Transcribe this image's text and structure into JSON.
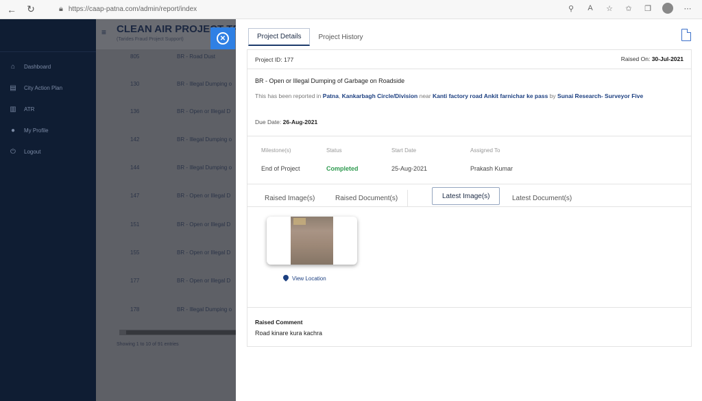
{
  "browser": {
    "url": "https://caap-patna.com/admin/report/index"
  },
  "sidebar": {
    "items": [
      {
        "label": "Dashboard"
      },
      {
        "label": "City Action Plan"
      },
      {
        "label": "ATR"
      },
      {
        "label": "My Profile"
      },
      {
        "label": "Logout"
      }
    ]
  },
  "main": {
    "title": "CLEAN AIR PROJECT TR",
    "subtitle": "(Tarides Fraud Project Support)",
    "rows": [
      {
        "id": "805",
        "category": "BR - Road Dust"
      },
      {
        "id": "130",
        "category": "BR - Illegal Dumping o"
      },
      {
        "id": "136",
        "category": "BR - Open or Illegal D"
      },
      {
        "id": "142",
        "category": "BR - Illegal Dumping o"
      },
      {
        "id": "144",
        "category": "BR - Illegal Dumping o"
      },
      {
        "id": "147",
        "category": "BR - Open or Illegal D"
      },
      {
        "id": "151",
        "category": "BR - Open or Illegal D"
      },
      {
        "id": "155",
        "category": "BR - Open or Illegal D"
      },
      {
        "id": "177",
        "category": "BR - Open or Illegal D"
      },
      {
        "id": "178",
        "category": "BR - Illegal Dumping o"
      }
    ],
    "showing": "Showing 1 to 10 of 91 entries"
  },
  "panel": {
    "tabs": [
      "Project Details",
      "Project History"
    ],
    "project_id_label": "Project ID:",
    "project_id": "177",
    "raised_on_label": "Raised On:",
    "raised_on": "30-Jul-2021",
    "title": "BR - Open or Illegal Dumping of Garbage on Roadside",
    "report": {
      "prefix": "This has been reported in",
      "city": "Patna",
      "division": "Kankarbagh Circle/Division",
      "near": "near",
      "location": "Kanti factory road Ankit farnichar ke pass",
      "by": "by",
      "reporter": "Sunai Research- Surveyor Five"
    },
    "due_label": "Due Date:",
    "due_date": "26-Aug-2021",
    "milestone": {
      "headers": [
        "Milestone(s)",
        "Status",
        "Start Date",
        "Assigned To"
      ],
      "values": [
        "End of Project",
        "Completed",
        "25-Aug-2021",
        "Prakash Kumar"
      ]
    },
    "subtabs": [
      "Raised Image(s)",
      "Raised Document(s)",
      "Latest Image(s)",
      "Latest Document(s)"
    ],
    "view_location": "View Location",
    "comment_label": "Raised Comment",
    "comment": "Road kinare kura kachra"
  }
}
